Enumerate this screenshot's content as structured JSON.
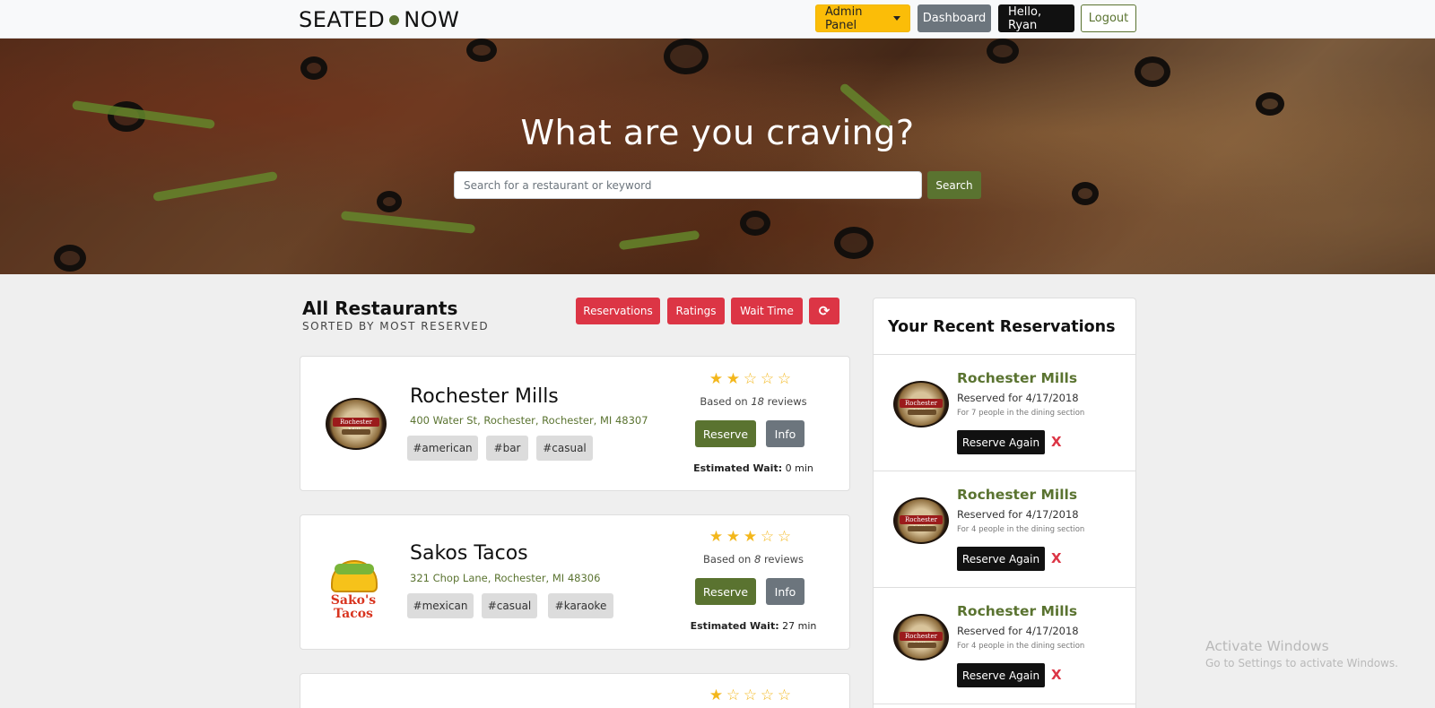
{
  "nav": {
    "brand_left": "SEATED",
    "brand_right": "NOW",
    "admin_label": "Admin Panel",
    "dashboard_label": "Dashboard",
    "hello_label": "Hello, Ryan",
    "logout_label": "Logout"
  },
  "hero": {
    "title": "What are you craving?",
    "search_placeholder": "Search for a restaurant or keyword",
    "search_button": "Search"
  },
  "list": {
    "title": "All Restaurants",
    "subtitle": "SORTED BY MOST RESERVED",
    "sort_buttons": [
      "Reservations",
      "Ratings",
      "Wait Time",
      "⟳"
    ]
  },
  "restaurants": [
    {
      "name": "Rochester Mills",
      "address": "400 Water St, Rochester, Rochester, MI 48307",
      "tags": [
        "#american",
        "#bar",
        "#casual"
      ],
      "rating": 2,
      "reviews_prefix": "Based on",
      "reviews_count": "18",
      "reviews_suffix": "reviews",
      "reserve_label": "Reserve",
      "info_label": "Info",
      "wait_label": "Estimated Wait:",
      "wait_value": "0 min"
    },
    {
      "name": "Sakos Tacos",
      "address": "321 Chop Lane, Rochester, MI 48306",
      "tags": [
        "#mexican",
        "#casual",
        "#karaoke"
      ],
      "rating": 3,
      "reviews_prefix": "Based on",
      "reviews_count": "8",
      "reviews_suffix": "reviews",
      "reserve_label": "Reserve",
      "info_label": "Info",
      "wait_label": "Estimated Wait:",
      "wait_value": "27 min",
      "logo_text_1": "Sako's",
      "logo_text_2": "Tacos"
    },
    {
      "rating": 1
    }
  ],
  "sidebar": {
    "title": "Your Recent Reservations",
    "items": [
      {
        "name": "Rochester Mills",
        "date": "Reserved for 4/17/2018",
        "note": "For 7 people in the dining section",
        "again_label": "Reserve Again",
        "remove_label": "X"
      },
      {
        "name": "Rochester Mills",
        "date": "Reserved for 4/17/2018",
        "note": "For 4 people in the dining section",
        "again_label": "Reserve Again",
        "remove_label": "X"
      },
      {
        "name": "Rochester Mills",
        "date": "Reserved for 4/17/2018",
        "note": "For 4 people in the dining section",
        "again_label": "Reserve Again",
        "remove_label": "X"
      }
    ]
  },
  "logo_mills_text": "Rochester Mills",
  "windows": {
    "title": "Activate Windows",
    "subtitle": "Go to Settings to activate Windows."
  },
  "colors": {
    "accent_green": "#5a7330",
    "admin_yellow": "#fbbd08",
    "danger_red": "#dc3545",
    "star_gold": "#f3b71c"
  },
  "icons": {
    "refresh": "refresh-icon",
    "caret": "caret-down-icon",
    "star_full": "star-filled-icon",
    "star_empty": "star-empty-icon"
  }
}
